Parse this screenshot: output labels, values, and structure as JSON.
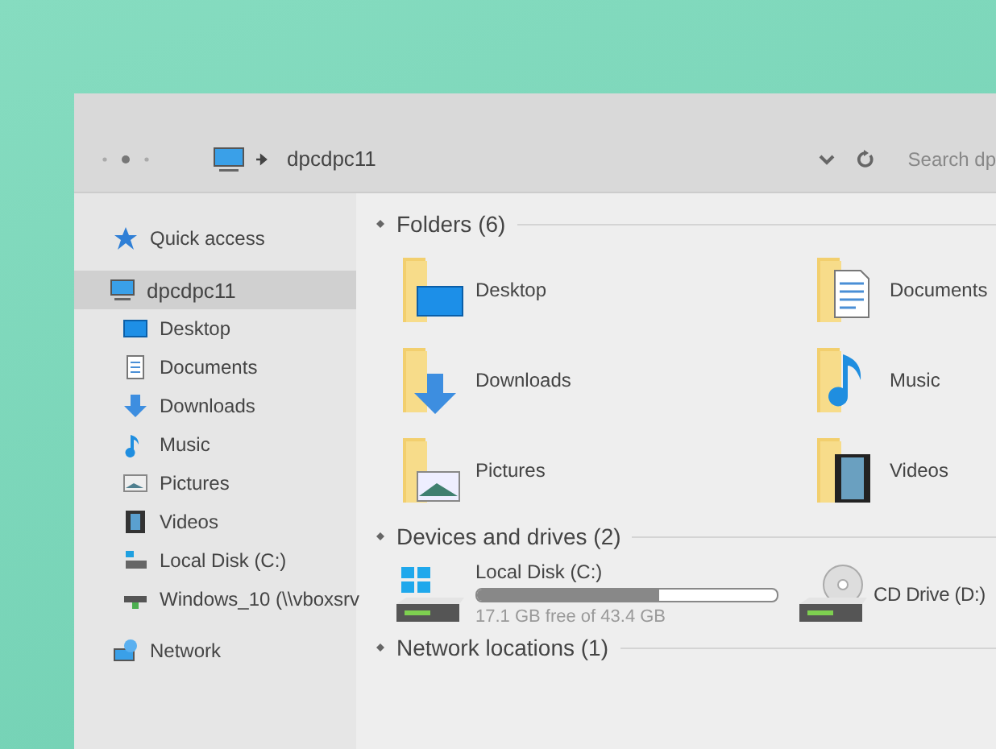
{
  "address_bar": {
    "location": "dpcdpc11"
  },
  "search": {
    "placeholder": "Search dp"
  },
  "sidebar": {
    "items": [
      {
        "label": "Quick access",
        "selected": false
      },
      {
        "label": "dpcdpc11",
        "selected": true,
        "children": [
          {
            "label": "Desktop",
            "selected": false
          },
          {
            "label": "Documents",
            "selected": false
          },
          {
            "label": "Downloads",
            "selected": false
          },
          {
            "label": "Music",
            "selected": false
          },
          {
            "label": "Pictures",
            "selected": false
          },
          {
            "label": "Videos",
            "selected": false
          },
          {
            "label": "Local Disk (C:)",
            "selected": false
          },
          {
            "label": "Windows_10 (\\\\vboxsrv",
            "selected": false
          }
        ]
      },
      {
        "label": "Network",
        "selected": false
      }
    ]
  },
  "sections": [
    {
      "title": "Folders (6)",
      "folders": [
        "Desktop",
        "Documents",
        "Downloads",
        "Music",
        "Pictures",
        "Videos"
      ]
    },
    {
      "title": "Devices and drives (2)",
      "drives": [
        {
          "kind": "disk",
          "name": "Local Disk (C:)",
          "level": 0.61,
          "space": "17.1 GB free of 43.4 GB"
        },
        {
          "kind": "cd",
          "name": "CD Drive (D:)"
        }
      ]
    },
    {
      "title": "Network locations (1)"
    }
  ]
}
